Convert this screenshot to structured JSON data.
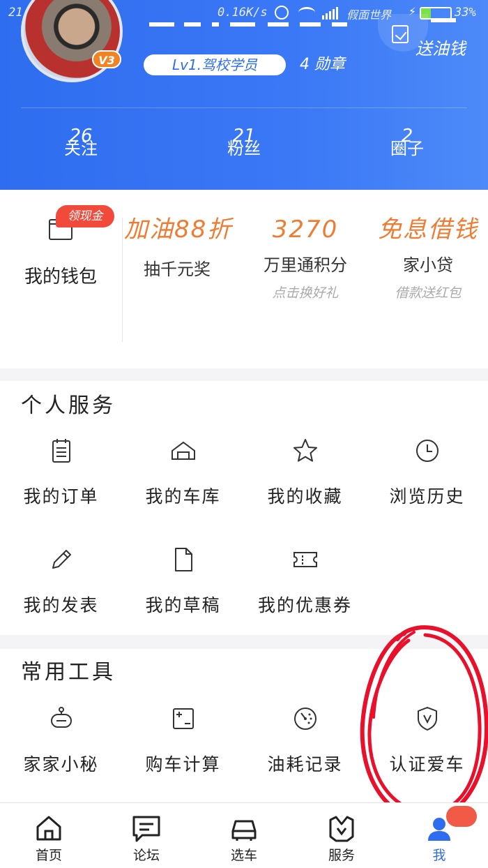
{
  "status_bar": {
    "time": "21:06",
    "speed": "0.16K/s",
    "carrier": "假面世界",
    "battery": "33%",
    "battery_level": 0.33
  },
  "profile": {
    "level_badge": "V3",
    "level_title": "Lv1.驾校学员",
    "medals": "4 勋章",
    "checkin_label": "送油钱"
  },
  "stats": [
    {
      "count": "26",
      "label": "关注"
    },
    {
      "count": "21",
      "label": "粉丝"
    },
    {
      "count": "2",
      "label": "圈子"
    }
  ],
  "wallet": {
    "tag": "领现金",
    "label": "我的钱包"
  },
  "promos": [
    {
      "headline": "加油88折",
      "title": "抽千元奖",
      "subtitle": ""
    },
    {
      "headline": "3270",
      "title": "万里通积分",
      "subtitle": "点击换好礼"
    },
    {
      "headline": "免息借钱",
      "title": "家小贷",
      "subtitle": "借款送红包"
    }
  ],
  "personal_services": {
    "title": "个人服务",
    "items": [
      {
        "label": "我的订单",
        "icon": "order-list-icon"
      },
      {
        "label": "我的车库",
        "icon": "garage-icon"
      },
      {
        "label": "我的收藏",
        "icon": "star-icon"
      },
      {
        "label": "浏览历史",
        "icon": "clock-icon"
      },
      {
        "label": "我的发表",
        "icon": "pencil-icon"
      },
      {
        "label": "我的草稿",
        "icon": "document-icon"
      },
      {
        "label": "我的优惠券",
        "icon": "coupon-icon"
      }
    ]
  },
  "common_tools": {
    "title": "常用工具",
    "items": [
      {
        "label": "家家小秘",
        "icon": "robot-icon"
      },
      {
        "label": "购车计算",
        "icon": "calculator-icon"
      },
      {
        "label": "油耗记录",
        "icon": "gauge-icon"
      },
      {
        "label": "认证爱车",
        "icon": "shield-v-icon"
      }
    ]
  },
  "bottom_nav": [
    {
      "label": "首页",
      "icon": "home-icon"
    },
    {
      "label": "论坛",
      "icon": "forum-icon"
    },
    {
      "label": "选车",
      "icon": "car-icon"
    },
    {
      "label": "服务",
      "icon": "service-icon"
    },
    {
      "label": "我",
      "icon": "profile-icon"
    }
  ],
  "colors": {
    "primary": "#2f6df0",
    "promo_orange": "#ee7c32",
    "tag_red": "#f24a3a",
    "annotation_red": "#e8102a"
  }
}
